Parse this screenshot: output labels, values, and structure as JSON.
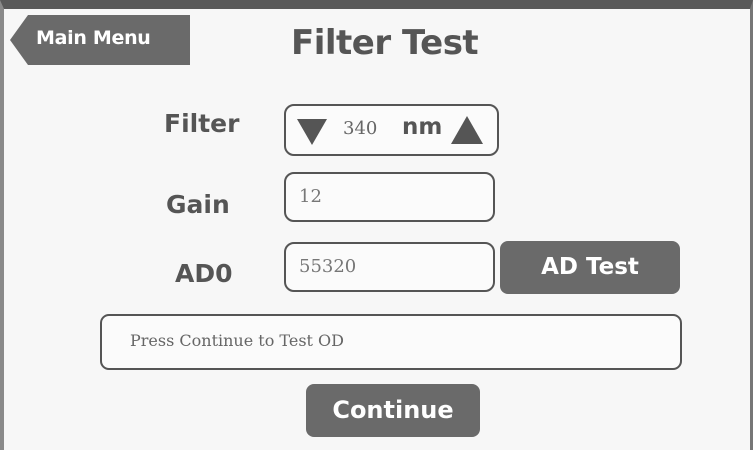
{
  "header": {
    "back_label": "Main Menu",
    "title": "Filter Test"
  },
  "filter": {
    "label": "Filter",
    "value": "340",
    "unit": "nm"
  },
  "gain": {
    "label": "Gain",
    "value": "12"
  },
  "ad0": {
    "label": "AD0",
    "value": "55320",
    "button_label": "AD Test"
  },
  "message": "Press Continue to Test OD",
  "footer": {
    "continue_label": "Continue"
  },
  "colors": {
    "button": "#6a6a6a",
    "text": "#555555"
  }
}
